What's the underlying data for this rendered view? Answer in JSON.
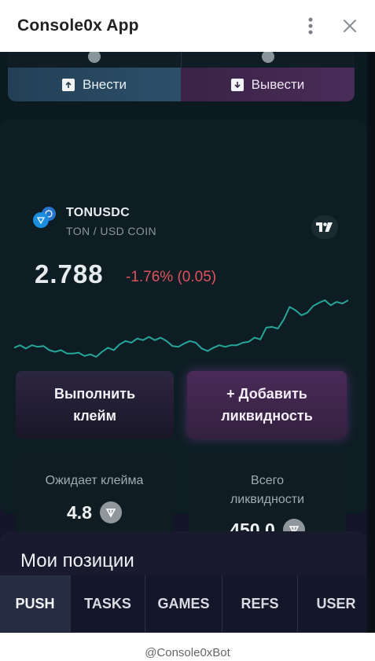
{
  "header": {
    "title": "Console0x App",
    "menu_icon": "more-vertical-icon",
    "close_icon": "close-icon"
  },
  "top_actions": {
    "deposit_label": "Внести",
    "withdraw_label": "Вывести"
  },
  "pair": {
    "name": "TONUSDC",
    "subtitle": "TON / USD COIN",
    "price": "2.788",
    "change": "-1.76% (0.05)"
  },
  "chart_data": {
    "type": "line",
    "color": "#26a69a",
    "values": [
      2.823,
      2.826,
      2.822,
      2.826,
      2.824,
      2.825,
      2.82,
      2.818,
      2.82,
      2.816,
      2.816,
      2.817,
      2.813,
      2.815,
      2.812,
      2.818,
      2.823,
      2.82,
      2.827,
      2.831,
      2.829,
      2.834,
      2.832,
      2.836,
      2.832,
      2.835,
      2.831,
      2.825,
      2.824,
      2.828,
      2.831,
      2.829,
      2.822,
      2.819,
      2.823,
      2.826,
      2.824,
      2.826,
      2.826,
      2.829,
      2.83,
      2.835,
      2.833,
      2.847,
      2.848,
      2.846,
      2.857,
      2.872,
      2.868,
      2.862,
      2.865,
      2.873,
      2.877,
      2.88,
      2.874,
      2.878,
      2.876,
      2.88
    ]
  },
  "actions": {
    "claim_label": "Выполнить клейм",
    "add_liquidity_label": "+ Добавить ликвидность"
  },
  "stats": {
    "pending_label": "Ожидает клейма",
    "pending_value": "4.8",
    "liquidity_label": "Всего ликвидности",
    "liquidity_value": "450.0"
  },
  "positions": {
    "title": "Мои позиции"
  },
  "nav": {
    "tabs": [
      "PUSH",
      "TASKS",
      "GAMES",
      "REFS",
      "USER"
    ],
    "active": "PUSH"
  },
  "footer": {
    "bot_handle": "@Console0xBot"
  }
}
